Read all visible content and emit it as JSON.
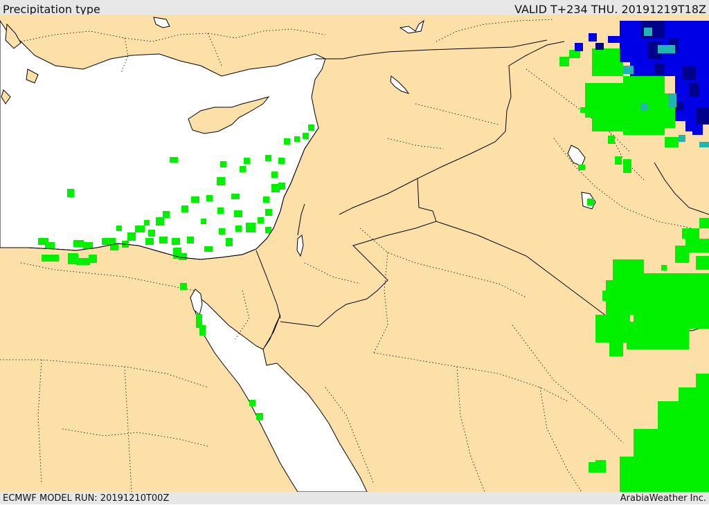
{
  "header": {
    "title": "Precipitation type",
    "valid": "VALID T+234 THU. 20191219T18Z"
  },
  "footer": {
    "model_run": "ECMWF MODEL RUN: 20191210T00Z",
    "credit": "ArabiaWeather Inc."
  },
  "colors": {
    "land": "#fce0a8",
    "sea": "#ffffff",
    "rain": "#00f000",
    "snow": "#0000e6",
    "heavy_snow": "#00008b",
    "mixed": "#22b5b0",
    "border": "#000000"
  }
}
